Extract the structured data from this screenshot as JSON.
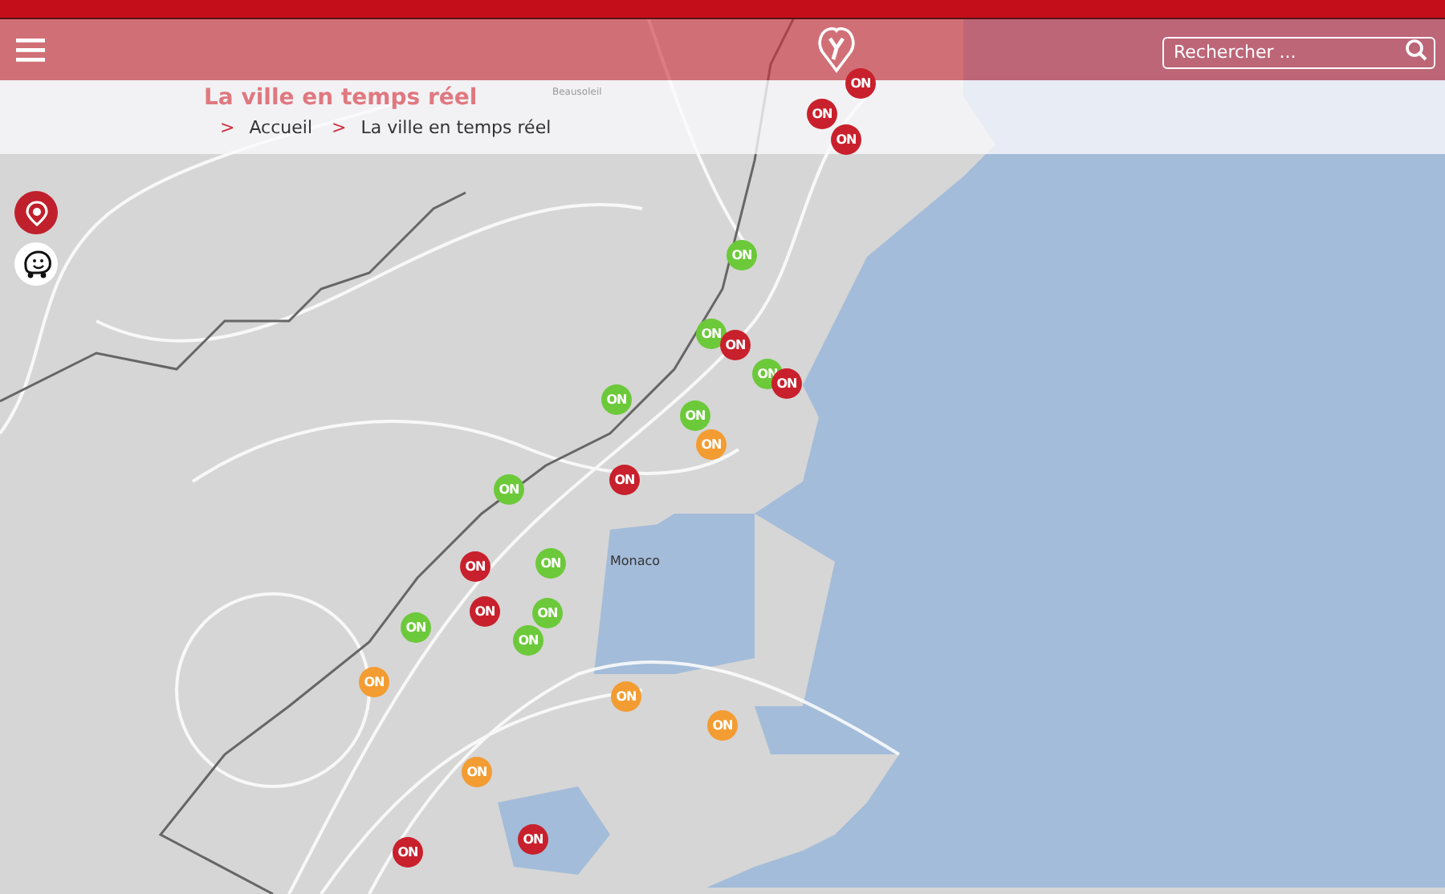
{
  "header": {
    "search": {
      "placeholder": "Rechercher ..."
    }
  },
  "page_title": "La ville en temps réel",
  "breadcrumb": [
    {
      "separator": ">",
      "label": "Accueil"
    },
    {
      "separator": ">",
      "label": "La ville en temps réel"
    }
  ],
  "map": {
    "place_labels": [
      {
        "kind": "town",
        "label": "Beausoleil"
      },
      {
        "kind": "city",
        "label": "Monaco"
      }
    ],
    "markers": [
      {
        "label": "ON",
        "color": "#c8202c"
      },
      {
        "label": "ON",
        "color": "#c8202c"
      },
      {
        "label": "ON",
        "color": "#c8202c"
      },
      {
        "label": "ON",
        "color": "#6cc93a"
      },
      {
        "label": "ON",
        "color": "#6cc93a"
      },
      {
        "label": "ON",
        "color": "#c8202c"
      },
      {
        "label": "ON",
        "color": "#6cc93a"
      },
      {
        "label": "ON",
        "color": "#c8202c"
      },
      {
        "label": "ON",
        "color": "#6cc93a"
      },
      {
        "label": "ON",
        "color": "#6cc93a"
      },
      {
        "label": "ON",
        "color": "#f39c32"
      },
      {
        "label": "ON",
        "color": "#c8202c"
      },
      {
        "label": "ON",
        "color": "#6cc93a"
      },
      {
        "label": "ON",
        "color": "#c8202c"
      },
      {
        "label": "ON",
        "color": "#6cc93a"
      },
      {
        "label": "ON",
        "color": "#c8202c"
      },
      {
        "label": "ON",
        "color": "#6cc93a"
      },
      {
        "label": "ON",
        "color": "#6cc93a"
      },
      {
        "label": "ON",
        "color": "#6cc93a"
      },
      {
        "label": "ON",
        "color": "#f39c32"
      },
      {
        "label": "ON",
        "color": "#f39c32"
      },
      {
        "label": "ON",
        "color": "#f39c32"
      },
      {
        "label": "ON",
        "color": "#f39c32"
      },
      {
        "label": "ON",
        "color": "#c8202c"
      },
      {
        "label": "ON",
        "color": "#c8202c"
      }
    ]
  }
}
